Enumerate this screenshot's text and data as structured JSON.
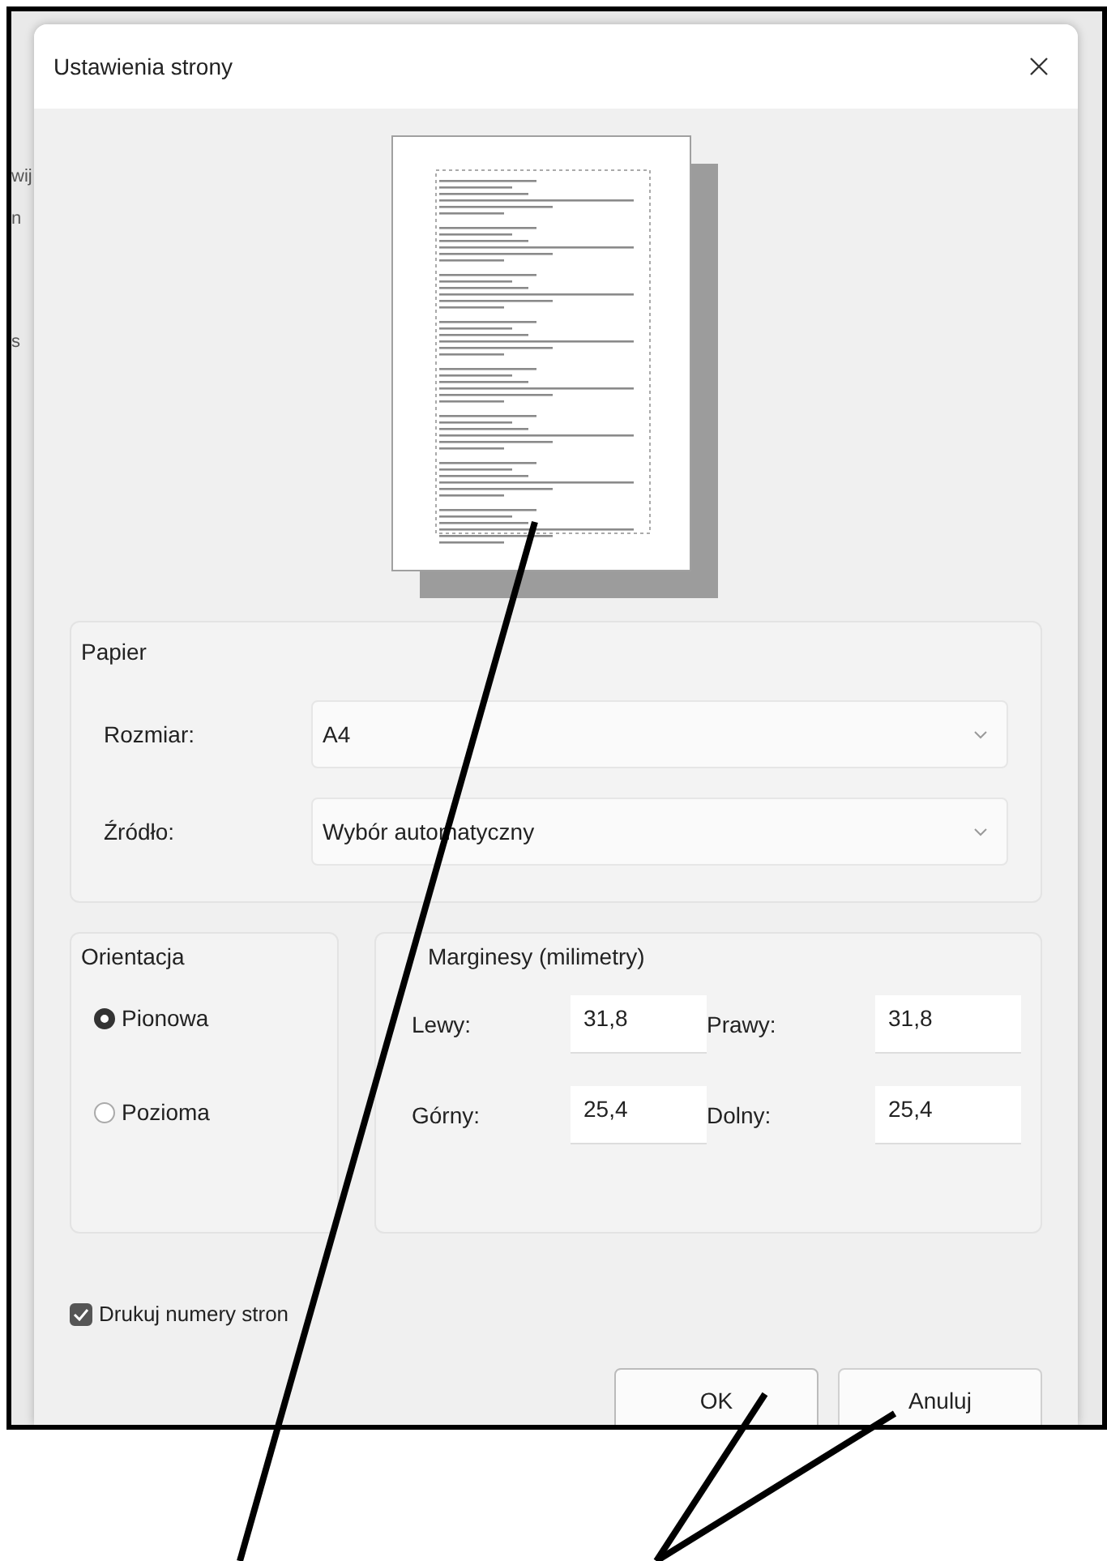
{
  "background_fragments": [
    "wij",
    "n",
    "s"
  ],
  "dialog": {
    "title": "Ustawienia strony"
  },
  "paper": {
    "legend": "Papier",
    "fields": [
      {
        "label": "Rozmiar:",
        "value": "A4"
      },
      {
        "label": "Źródło:",
        "value": "Wybór automatyczny"
      }
    ]
  },
  "orientation": {
    "legend": "Orientacja",
    "options": [
      {
        "label": "Pionowa",
        "selected": true
      },
      {
        "label": "Pozioma",
        "selected": false
      }
    ]
  },
  "margins": {
    "legend": "Marginesy (milimetry)",
    "fields": [
      {
        "label": "Lewy:",
        "value": "31,8"
      },
      {
        "label": "Prawy:",
        "value": "31,8"
      },
      {
        "label": "Górny:",
        "value": "25,4"
      },
      {
        "label": "Dolny:",
        "value": "25,4"
      }
    ]
  },
  "print_page_numbers": {
    "label": "Drukuj numery stron",
    "checked": true
  },
  "buttons": [
    "OK",
    "Anuluj"
  ]
}
